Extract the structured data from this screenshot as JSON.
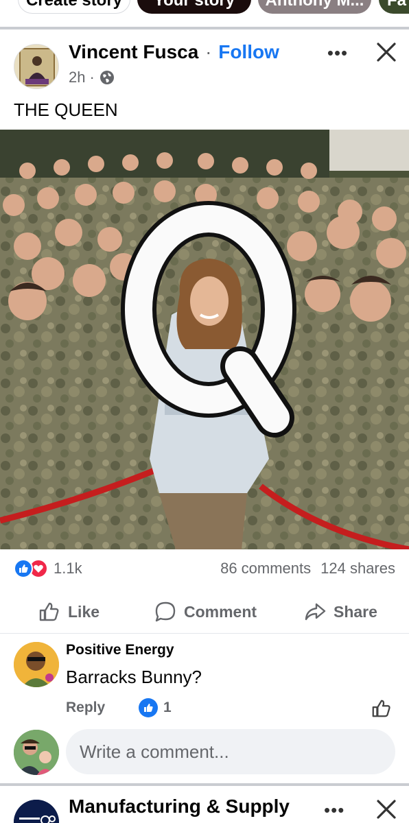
{
  "stories": {
    "items": [
      {
        "label": "Create story"
      },
      {
        "label": "Your story"
      },
      {
        "label": "Anthony M..."
      },
      {
        "label": "Fa"
      }
    ]
  },
  "post": {
    "author": "Vincent Fusca",
    "separator": "·",
    "follow_label": "Follow",
    "time": "2h",
    "time_sep": "·",
    "audience_icon": "globe-icon",
    "more_icon": "more-icon",
    "more_glyph": "•••",
    "close_icon": "close-icon",
    "text": "THE QUEEN",
    "image_letter": "Q",
    "reactions": {
      "icons": [
        "like-reaction-icon",
        "love-reaction-icon"
      ],
      "count": "1.1k"
    },
    "comments_count": "86 comments",
    "shares_count": "124 shares",
    "actions": {
      "like": "Like",
      "comment": "Comment",
      "share": "Share"
    }
  },
  "comment": {
    "author": "Positive Energy",
    "text": "Barracks Bunny?",
    "reply_label": "Reply",
    "like_count": "1"
  },
  "composer": {
    "placeholder": "Write a comment..."
  },
  "next_post": {
    "author": "Manufacturing & Supply",
    "more_glyph": "•••"
  },
  "colors": {
    "accent": "#1877f2",
    "love": "#f02849",
    "muted": "#65676b",
    "divider": "#c9ccd1"
  }
}
